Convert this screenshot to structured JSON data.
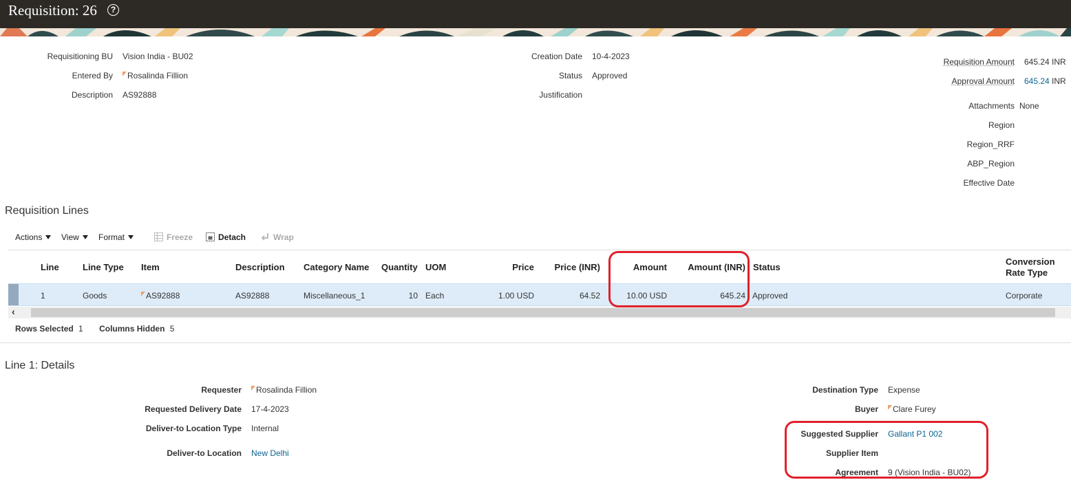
{
  "header": {
    "title": "Requisition: 26",
    "help_icon": "?"
  },
  "summary": {
    "requisitioning_bu_label": "Requisitioning BU",
    "requisitioning_bu_value": "Vision India - BU02",
    "entered_by_label": "Entered By",
    "entered_by_value": "Rosalinda Fillion",
    "description_label": "Description",
    "description_value": "AS92888",
    "creation_date_label": "Creation Date",
    "creation_date_value": "10-4-2023",
    "status_label": "Status",
    "status_value": "Approved",
    "justification_label": "Justification",
    "requisition_amount_label": "Requisition Amount",
    "requisition_amount_value": "645.24",
    "requisition_amount_currency": "INR",
    "approval_amount_label": "Approval Amount",
    "approval_amount_value": "645.24",
    "approval_amount_currency": "INR",
    "attachments_label": "Attachments",
    "attachments_value": "None",
    "region_label": "Region",
    "region_rrf_label": "Region_RRF",
    "abp_region_label": "ABP_Region",
    "effective_date_label": "Effective Date"
  },
  "lines_section": {
    "title": "Requisition Lines",
    "toolbar": {
      "actions": "Actions",
      "view": "View",
      "format": "Format",
      "freeze": "Freeze",
      "detach": "Detach",
      "wrap": "Wrap"
    },
    "columns": {
      "line": "Line",
      "line_type": "Line Type",
      "item": "Item",
      "description": "Description",
      "category_name": "Category Name",
      "quantity": "Quantity",
      "uom": "UOM",
      "price": "Price",
      "price_inr": "Price (INR)",
      "amount": "Amount",
      "amount_inr": "Amount (INR)",
      "status": "Status",
      "conversion_rate_type_1": "Conversion",
      "conversion_rate_type_2": "Rate Type"
    },
    "rows": [
      {
        "line": "1",
        "line_type": "Goods",
        "item": "AS92888",
        "description": "AS92888",
        "category_name": "Miscellaneous_1",
        "quantity": "10",
        "uom": "Each",
        "price": "1.00",
        "price_currency": "USD",
        "price_inr": "64.52",
        "amount": "10.00",
        "amount_currency": "USD",
        "amount_inr": "645.24",
        "status": "Approved",
        "conversion_rate_type": "Corporate"
      }
    ],
    "footer": {
      "rows_selected_label": "Rows Selected",
      "rows_selected_value": "1",
      "columns_hidden_label": "Columns Hidden",
      "columns_hidden_value": "5"
    }
  },
  "details": {
    "title": "Line 1: Details",
    "requester_label": "Requester",
    "requester_value": "Rosalinda Fillion",
    "requested_delivery_date_label": "Requested Delivery Date",
    "requested_delivery_date_value": "17-4-2023",
    "deliver_to_location_type_label": "Deliver-to Location Type",
    "deliver_to_location_type_value": "Internal",
    "deliver_to_location_label": "Deliver-to Location",
    "deliver_to_location_value": "New Delhi",
    "destination_type_label": "Destination Type",
    "destination_type_value": "Expense",
    "buyer_label": "Buyer",
    "buyer_value": "Clare Furey",
    "suggested_supplier_label": "Suggested Supplier",
    "suggested_supplier_value": "Gallant P1 002",
    "supplier_item_label": "Supplier Item",
    "agreement_label": "Agreement",
    "agreement_value": "9 (Vision India - BU02)"
  },
  "colors": {
    "title_bar": "#2d2a26",
    "link": "#0c6591",
    "selected_row": "#deecf9",
    "annotation": "#e0202a"
  }
}
